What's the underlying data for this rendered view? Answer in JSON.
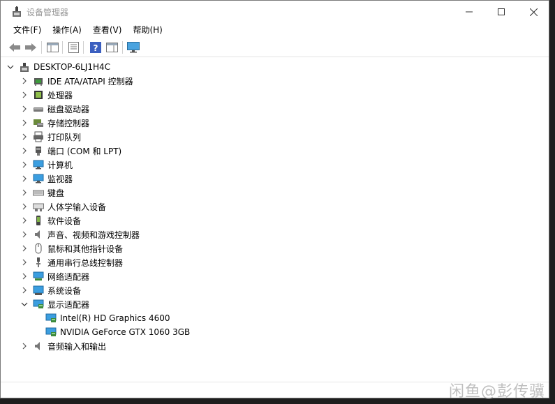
{
  "window": {
    "title": "设备管理器",
    "icon": "device-manager-icon"
  },
  "menu": [
    {
      "label": "文件(F)"
    },
    {
      "label": "操作(A)"
    },
    {
      "label": "查看(V)"
    },
    {
      "label": "帮助(H)"
    }
  ],
  "toolbar": {
    "buttons": [
      "back-arrow-icon",
      "forward-arrow-icon",
      "show-hide-tree-icon",
      "properties-icon",
      "help-icon",
      "action-pane-icon",
      "monitor-icon"
    ]
  },
  "tree": {
    "root": "DESKTOP-6LJ1H4C",
    "categories": [
      {
        "label": "IDE ATA/ATAPI 控制器",
        "icon": "ide-controller-icon",
        "expanded": false
      },
      {
        "label": "处理器",
        "icon": "processor-icon",
        "expanded": false
      },
      {
        "label": "磁盘驱动器",
        "icon": "disk-drive-icon",
        "expanded": false
      },
      {
        "label": "存储控制器",
        "icon": "storage-controller-icon",
        "expanded": false
      },
      {
        "label": "打印队列",
        "icon": "printer-icon",
        "expanded": false
      },
      {
        "label": "端口 (COM 和 LPT)",
        "icon": "port-icon",
        "expanded": false
      },
      {
        "label": "计算机",
        "icon": "computer-icon",
        "expanded": false
      },
      {
        "label": "监视器",
        "icon": "monitor-icon",
        "expanded": false
      },
      {
        "label": "键盘",
        "icon": "keyboard-icon",
        "expanded": false
      },
      {
        "label": "人体学输入设备",
        "icon": "hid-icon",
        "expanded": false
      },
      {
        "label": "软件设备",
        "icon": "software-device-icon",
        "expanded": false
      },
      {
        "label": "声音、视频和游戏控制器",
        "icon": "speaker-icon",
        "expanded": false
      },
      {
        "label": "鼠标和其他指针设备",
        "icon": "mouse-icon",
        "expanded": false
      },
      {
        "label": "通用串行总线控制器",
        "icon": "usb-icon",
        "expanded": false
      },
      {
        "label": "网络适配器",
        "icon": "network-adapter-icon",
        "expanded": false
      },
      {
        "label": "系统设备",
        "icon": "system-device-icon",
        "expanded": false
      },
      {
        "label": "显示适配器",
        "icon": "display-adapter-icon",
        "expanded": true
      },
      {
        "label": "音频输入和输出",
        "icon": "audio-io-icon",
        "expanded": false
      }
    ],
    "display_adapters": [
      {
        "label": "Intel(R) HD Graphics 4600",
        "icon": "display-adapter-icon"
      },
      {
        "label": "NVIDIA GeForce GTX 1060 3GB",
        "icon": "display-adapter-icon"
      }
    ]
  },
  "watermark": "闲鱼@彭传骥",
  "colors": {
    "accent": "#1e6fc8",
    "title_text": "#999999",
    "window_border": "#7a7a7a"
  }
}
